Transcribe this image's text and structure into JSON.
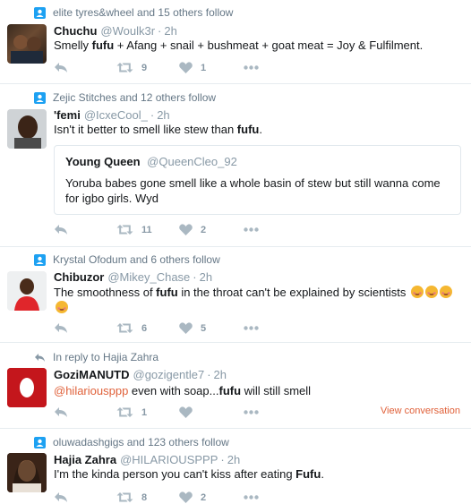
{
  "tweets": [
    {
      "context": "elite tyres&wheel and 15 others follow",
      "name": "Chuchu",
      "handle": "@Woulk3r",
      "time": "2h",
      "text_parts": [
        "Smelly ",
        "fufu",
        " + Afang + snail + bushmeat + goat meat = Joy & Fulfilment."
      ],
      "retweets": "9",
      "likes": "1"
    },
    {
      "context": "Zejic Stitches and 12 others follow",
      "name": "'femi",
      "handle": "@IcxeCool_",
      "time": "2h",
      "text_parts": [
        "Isn't it better to smell like stew than ",
        "fufu",
        "."
      ],
      "quote": {
        "name": "Young Queen",
        "handle": "@QueenCleo_92",
        "text": "Yoruba babes gone smell like a whole basin of stew but still wanna come for igbo girls. Wyd"
      },
      "retweets": "11",
      "likes": "2"
    },
    {
      "context": "Krystal Ofodum and 6 others follow",
      "name": "Chibuzor",
      "handle": "@Mikey_Chase",
      "time": "2h",
      "text_parts": [
        "The smoothness of ",
        "fufu",
        " in the throat can't be explained by scientists"
      ],
      "retweets": "6",
      "likes": "5"
    },
    {
      "context": "In reply to Hajia Zahra",
      "name": "GoziMANUTD",
      "handle": "@gozigentle7",
      "time": "2h",
      "mention": "@hilariousppp",
      "text_parts": [
        " even  with soap...",
        "fufu",
        " will still smell"
      ],
      "retweets": "1",
      "likes": "",
      "view_conversation": "View conversation"
    },
    {
      "context": "oluwadashgigs and 123 others follow",
      "name": "Hajia Zahra",
      "handle": "@HILARIOUSPPP",
      "time": "2h",
      "text_parts": [
        "I'm the kinda person you can't kiss after eating ",
        "Fufu",
        "."
      ],
      "retweets": "8",
      "likes": "2"
    }
  ],
  "colors": {
    "accent": "#e0613a",
    "context_icon": "#1da1f2",
    "action_gray": "#aab8c2",
    "meta_gray": "#8899a6",
    "divider": "#e6ecf0"
  },
  "icons": [
    "person-follow-icon",
    "reply-arrow-icon",
    "reply-icon",
    "retweet-icon",
    "like-heart-icon",
    "more-dots-icon",
    "smiling-face-emoji"
  ]
}
